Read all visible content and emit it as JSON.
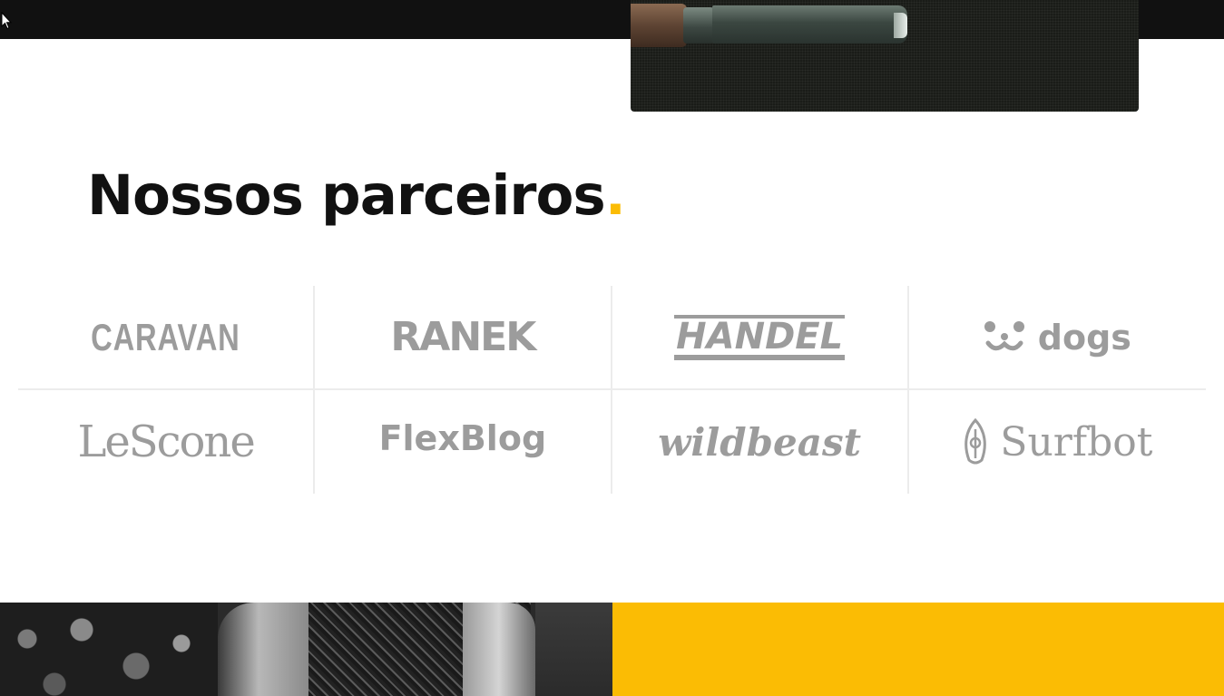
{
  "section": {
    "title": "Nossos parceiros",
    "title_accent": "."
  },
  "colors": {
    "accent": "#fbbc04",
    "topbar": "#111111",
    "logo_gray": "#9c9c9c"
  },
  "partners": [
    {
      "name": "CARAVAN",
      "icon": null
    },
    {
      "name": "RANEK",
      "icon": null
    },
    {
      "name": "HANDEL",
      "icon": null
    },
    {
      "name": "dogs",
      "icon": "dog-face-icon"
    },
    {
      "name": "LeScone",
      "icon": null
    },
    {
      "name": "FlexBlog",
      "icon": null
    },
    {
      "name": "wildbeast",
      "icon": null
    },
    {
      "name": "Surfbot",
      "icon": "surfboard-icon"
    }
  ]
}
